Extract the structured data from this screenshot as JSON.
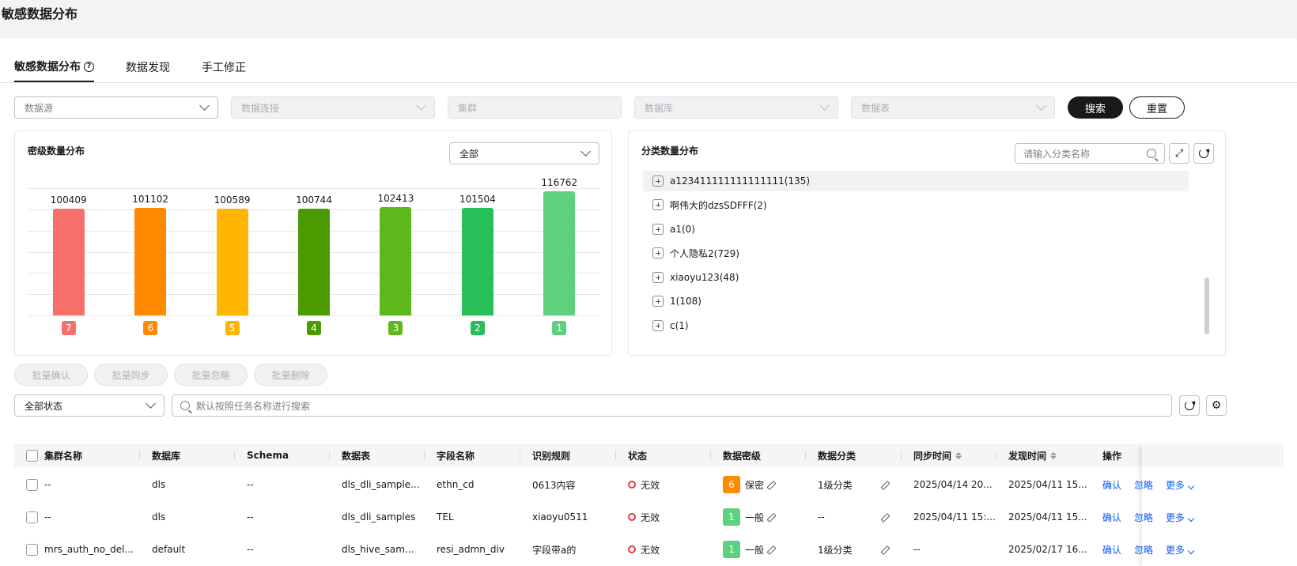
{
  "page_title": "敏感数据分布",
  "tabs": [
    {
      "label": "敏感数据分布",
      "active": true
    },
    {
      "label": "数据发现",
      "active": false
    },
    {
      "label": "手工修正",
      "active": false
    }
  ],
  "filters": {
    "datasource": "数据源",
    "connection": "数据连接",
    "cluster": "集群",
    "database": "数据库",
    "table": "数据表",
    "search_label": "搜索",
    "reset_label": "重置"
  },
  "level_card": {
    "title": "密级数量分布",
    "select_value": "全部"
  },
  "chart_data": {
    "type": "bar",
    "categories": [
      "7",
      "6",
      "5",
      "4",
      "3",
      "2",
      "1"
    ],
    "values": [
      100409,
      101102,
      100589,
      100744,
      102413,
      101504,
      116762
    ],
    "colors": [
      "#f66f6a",
      "#ff8a00",
      "#ffb400",
      "#4a9b00",
      "#5fb81b",
      "#26bf5a",
      "#5ed17f"
    ],
    "grid": true
  },
  "class_card": {
    "title": "分类数量分布",
    "search_placeholder": "请输入分类名称",
    "items": [
      "a123411111111111111(135)",
      "啊伟大的dzsSDFFF(2)",
      "a1(0)",
      "个人隐私2(729)",
      "xiaoyu123(48)",
      "1(108)",
      "c(1)"
    ]
  },
  "batch_buttons": [
    "批量确认",
    "批量同步",
    "批量忽略",
    "批量删除"
  ],
  "table_toolbar": {
    "status_select": "全部状态",
    "search_placeholder": "默认按照任务名称进行搜索"
  },
  "table": {
    "columns": [
      "集群名称",
      "数据库",
      "Schema",
      "数据表",
      "字段名称",
      "识别规则",
      "状态",
      "数据密级",
      "数据分类",
      "同步时间",
      "发现时间",
      "操作"
    ],
    "rows": [
      {
        "cluster": "--",
        "database": "dls",
        "schema": "--",
        "table": "dls_dli_sample...",
        "field": "ethn_cd",
        "rule": "0613内容",
        "status": "无效",
        "level_num": "6",
        "level_name": "保密",
        "level_color": "#ff8a00",
        "category": "1级分类",
        "sync_time": "2025/04/14 20...",
        "found_time": "2025/04/11 15...",
        "actions": [
          "确认",
          "忽略",
          "更多"
        ]
      },
      {
        "cluster": "--",
        "database": "dls",
        "schema": "--",
        "table": "dls_dli_samples",
        "field": "TEL",
        "rule": "xiaoyu0511",
        "status": "无效",
        "level_num": "1",
        "level_name": "一般",
        "level_color": "#5ed17f",
        "category": "--",
        "sync_time": "2025/04/11 15:...",
        "found_time": "2025/04/11 15...",
        "actions": [
          "确认",
          "忽略",
          "更多"
        ]
      },
      {
        "cluster": "mrs_auth_no_del...",
        "database": "default",
        "schema": "--",
        "table": "dls_hive_sam...",
        "field": "resi_admn_div",
        "rule": "字段带a的",
        "status": "无效",
        "level_num": "1",
        "level_name": "一般",
        "level_color": "#5ed17f",
        "category": "1级分类",
        "sync_time": "--",
        "found_time": "2025/02/17 16...",
        "actions": [
          "确认",
          "忽略",
          "更多"
        ]
      }
    ]
  }
}
